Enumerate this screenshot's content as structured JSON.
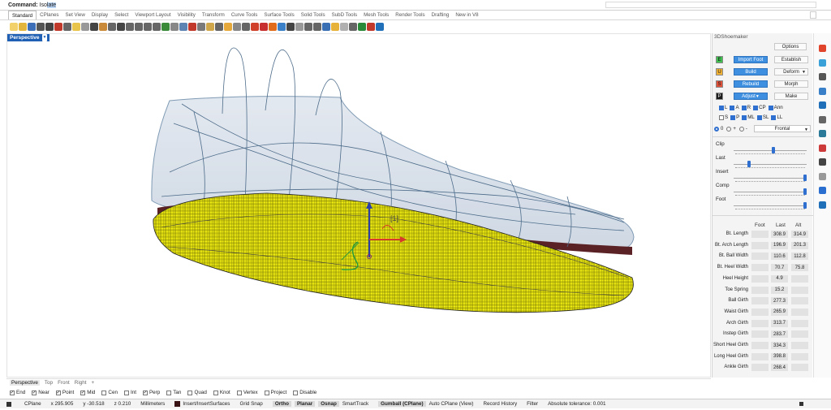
{
  "command": {
    "label": "Command:",
    "value_pre": "Iso",
    "value_sel": "late"
  },
  "tabs": [
    "Standard",
    "CPlanes",
    "Set View",
    "Display",
    "Select",
    "Viewport Layout",
    "Visibility",
    "Transform",
    "Curve Tools",
    "Surface Tools",
    "Solid Tools",
    "SubD Tools",
    "Mesh Tools",
    "Render Tools",
    "Drafting",
    "New in V8"
  ],
  "active_tab": "Standard",
  "toolbar_icon_colors": [
    "#f2d16b",
    "#e3b63b",
    "#3c6fb7",
    "#555",
    "#444",
    "#c0392b",
    "#666",
    "#e9c44a",
    "#999",
    "#444",
    "#c98a3a",
    "#666",
    "#444",
    "#666",
    "#666",
    "#666",
    "#666",
    "#3a8a3a",
    "#888",
    "#5d83b3",
    "#c0392b",
    "#7a7a7a",
    "#d0a84b",
    "#666",
    "#e5a93b",
    "#888",
    "#666",
    "#d0402a",
    "#c83030",
    "#e06b1a",
    "#3a80c8",
    "#444",
    "#999",
    "#666",
    "#666",
    "#3a6fb4",
    "#e7b23a",
    "#b0b0b0",
    "#666",
    "#2b8a3a",
    "#c0392b",
    "#1f6fb9"
  ],
  "viewport": {
    "label": "Perspective",
    "tabs": [
      "Perspective",
      "Top",
      "Front",
      "Right"
    ],
    "add_icon": "+"
  },
  "osnaps": [
    {
      "label": "End",
      "on": true
    },
    {
      "label": "Near",
      "on": true
    },
    {
      "label": "Point",
      "on": true
    },
    {
      "label": "Mid",
      "on": true
    },
    {
      "label": "Cen",
      "on": false
    },
    {
      "label": "Int",
      "on": false
    },
    {
      "label": "Perp",
      "on": true
    },
    {
      "label": "Tan",
      "on": false
    },
    {
      "label": "Quad",
      "on": false
    },
    {
      "label": "Knot",
      "on": false
    },
    {
      "label": "Vertex",
      "on": false
    },
    {
      "label": "Project",
      "on": false
    },
    {
      "label": "Disable",
      "on": false
    }
  ],
  "status": {
    "cplane": "CPlane",
    "x": "x 295.905",
    "y": "y -30.518",
    "z": "z 0.210",
    "units": "Millimeters",
    "layer": "Insert/InsertSurfaces",
    "grid_snap": "Grid Snap",
    "ortho": "Ortho",
    "planar": "Planar",
    "osnap": "Osnap",
    "smarttrack": "SmartTrack",
    "gumball": "Gumball (CPlane)",
    "autocplane": "Auto CPlane (View)",
    "record": "Record History",
    "filter": "Filter",
    "tolerance": "Absolute tolerance: 0.001"
  },
  "panel": {
    "title": "3DShoemaker",
    "options": "Options",
    "rows": [
      {
        "letter": "E",
        "color": "#3fbf4f",
        "button": "Import Foot",
        "right": "Establish",
        "dropdown": false
      },
      {
        "letter": "U",
        "color": "#f2b233",
        "button": "Build",
        "right": "Deform",
        "dropdown": true
      },
      {
        "letter": "S",
        "color": "#e0513a",
        "button": "Rebuild",
        "right": "Morph",
        "dropdown": false
      },
      {
        "letter": "P",
        "color": "#1a1a1a",
        "button": "Adjust",
        "right": "Make",
        "dropdown": false
      }
    ],
    "checks_row1": [
      {
        "label": "L",
        "on": true
      },
      {
        "label": "A",
        "on": true
      },
      {
        "label": "R",
        "on": true
      },
      {
        "label": "CP",
        "on": true
      },
      {
        "label": "Ann",
        "on": true
      }
    ],
    "checks_row2": [
      {
        "label": "S",
        "on": false
      },
      {
        "label": "P",
        "on": true
      },
      {
        "label": "ML",
        "on": true
      },
      {
        "label": "SL",
        "on": true
      },
      {
        "label": "LL",
        "on": true
      }
    ],
    "radios": [
      {
        "label": "0",
        "on": true
      },
      {
        "label": "+",
        "on": false
      },
      {
        "label": "-",
        "on": false
      }
    ],
    "view_select": "Frontal",
    "sliders": [
      {
        "label": "Clip",
        "value": 0.55
      },
      {
        "label": "Last",
        "value": 0.2
      },
      {
        "label": "Insert",
        "value": 1.0
      },
      {
        "label": "Comp",
        "value": 1.0
      },
      {
        "label": "Foot",
        "value": 1.0
      }
    ],
    "measure_headers": [
      "Foot",
      "Last",
      "Alt"
    ],
    "measurements": [
      {
        "name": "Bt. Length",
        "foot": "",
        "last": "308.9",
        "alt": "314.9"
      },
      {
        "name": "Bt. Arch Length",
        "foot": "",
        "last": "196.9",
        "alt": "201.3"
      },
      {
        "name": "Bt. Ball Width",
        "foot": "",
        "last": "110.6",
        "alt": "112.8"
      },
      {
        "name": "Bt. Heel Width",
        "foot": "",
        "last": "70.7",
        "alt": "75.8"
      },
      {
        "name": "Heel Height",
        "foot": "",
        "last": "4.9",
        "alt": ""
      },
      {
        "name": "Toe Spring",
        "foot": "",
        "last": "15.2",
        "alt": ""
      },
      {
        "name": "Ball Girth",
        "foot": "",
        "last": "277.3",
        "alt": ""
      },
      {
        "name": "Waist Girth",
        "foot": "",
        "last": "265.9",
        "alt": ""
      },
      {
        "name": "Arch Girth",
        "foot": "",
        "last": "313.7",
        "alt": ""
      },
      {
        "name": "Instep Girth",
        "foot": "",
        "last": "283.7",
        "alt": ""
      },
      {
        "name": "Short Heel Girth",
        "foot": "",
        "last": "334.3",
        "alt": ""
      },
      {
        "name": "Long Heel Girth",
        "foot": "",
        "last": "398.8",
        "alt": ""
      },
      {
        "name": "Ankle Girth",
        "foot": "",
        "last": "268.4",
        "alt": ""
      }
    ]
  },
  "right_icon_colors": [
    "#e0452b",
    "#3aa0d8",
    "#555",
    "#3a80c8",
    "#1f6fb9",
    "#666",
    "#2b7a9a",
    "#cc3a3a",
    "#444",
    "#999",
    "#2a6fcf",
    "#1f6fb9"
  ],
  "gumball_label": "[1]"
}
